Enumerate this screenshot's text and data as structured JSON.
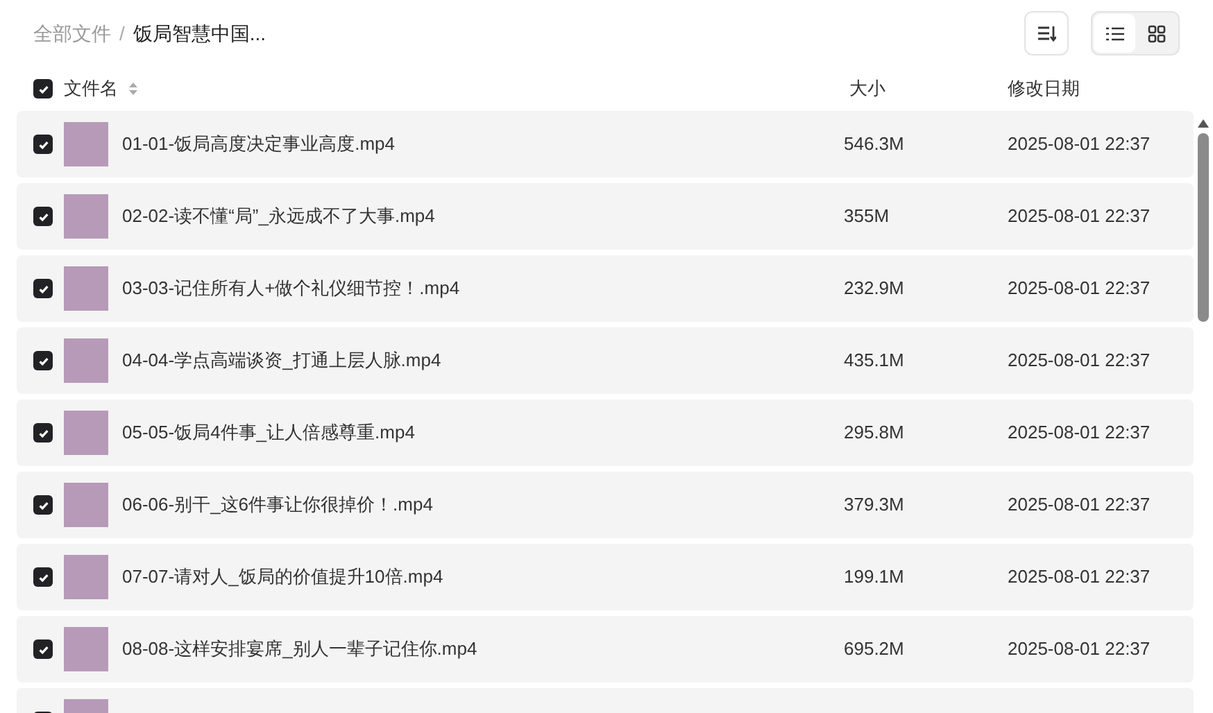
{
  "breadcrumb_separator": "/",
  "breadcrumb": [
    {
      "label": "全部文件",
      "current": false
    },
    {
      "label": "饭局智慧中国...",
      "current": true
    }
  ],
  "view_toggle": [
    {
      "kind": "list",
      "selected": true
    },
    {
      "kind": "grid",
      "selected": false
    }
  ],
  "header": {
    "checked": true,
    "name": "文件名",
    "size": "大小",
    "date": "修改日期"
  },
  "rows": [
    {
      "checked": true,
      "name": "01-01-饭局高度决定事业高度.mp4",
      "size": "546.3M",
      "date": "2025-08-01 22:37"
    },
    {
      "checked": true,
      "name": "02-02-读不懂“局”_永远成不了大事.mp4",
      "size": "355M",
      "date": "2025-08-01 22:37"
    },
    {
      "checked": true,
      "name": "03-03-记住所有人+做个礼仪细节控！.mp4",
      "size": "232.9M",
      "date": "2025-08-01 22:37"
    },
    {
      "checked": true,
      "name": "04-04-学点高端谈资_打通上层人脉.mp4",
      "size": "435.1M",
      "date": "2025-08-01 22:37"
    },
    {
      "checked": true,
      "name": "05-05-饭局4件事_让人倍感尊重.mp4",
      "size": "295.8M",
      "date": "2025-08-01 22:37"
    },
    {
      "checked": true,
      "name": "06-06-别干_这6件事让你很掉价！.mp4",
      "size": "379.3M",
      "date": "2025-08-01 22:37"
    },
    {
      "checked": true,
      "name": "07-07-请对人_饭局的价值提升10倍.mp4",
      "size": "199.1M",
      "date": "2025-08-01 22:37"
    },
    {
      "checked": true,
      "name": "08-08-这样安排宴席_别人一辈子记住你.mp4",
      "size": "695.2M",
      "date": "2025-08-01 22:37"
    },
    {
      "checked": true
    }
  ]
}
